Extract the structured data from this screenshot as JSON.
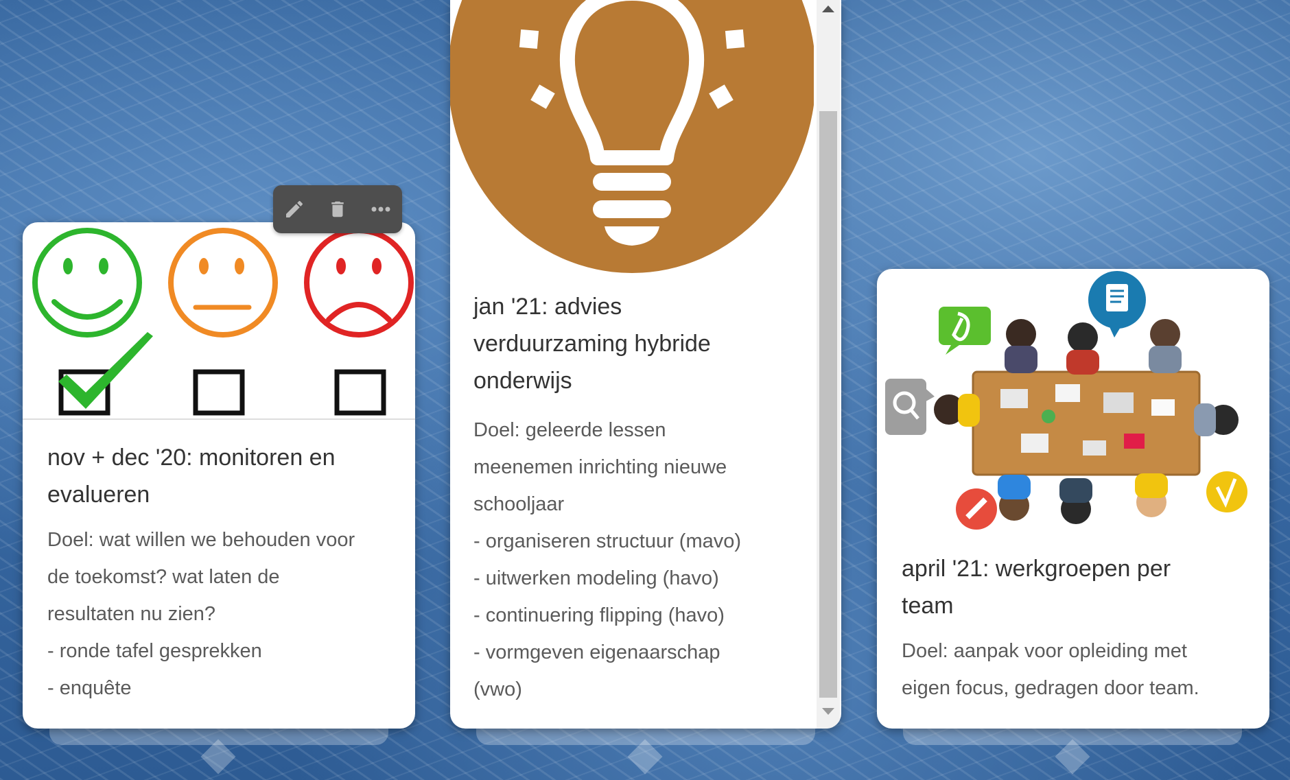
{
  "toolbar": {
    "edit_icon": "pencil-icon",
    "delete_icon": "trash-icon",
    "more_icon": "more-horizontal-icon"
  },
  "cards": [
    {
      "title": "nov + dec '20: monitoren en evalueren",
      "lines": [
        "Doel: wat willen we behouden voor",
        "de toekomst? wat laten de",
        "resultaten nu zien?",
        "- ronde tafel gesprekken",
        "- enquête"
      ],
      "image": "smiley-rating-checkboxes"
    },
    {
      "title_lines": [
        "jan '21: advies",
        "verduurzaming hybride",
        "onderwijs"
      ],
      "lines": [
        "Doel: geleerde lessen",
        "meenemen inrichting nieuwe",
        "schooljaar",
        "- organiseren structuur (mavo)",
        "- uitwerken modeling (havo)",
        "- continuering flipping (havo)",
        "- vormgeven eigenaarschap",
        "(vwo)"
      ],
      "image": "lightbulb-icon",
      "accent": "#b87a34"
    },
    {
      "title_lines": [
        "april '21: werkgroepen per",
        "team"
      ],
      "lines": [
        "Doel: aanpak voor opleiding met",
        "eigen focus, gedragen door team."
      ],
      "image": "team-meeting-table"
    }
  ],
  "colors": {
    "happy": "#2db52d",
    "neutral": "#f08a24",
    "sad": "#e02424",
    "bulb_bg": "#b87a34"
  }
}
